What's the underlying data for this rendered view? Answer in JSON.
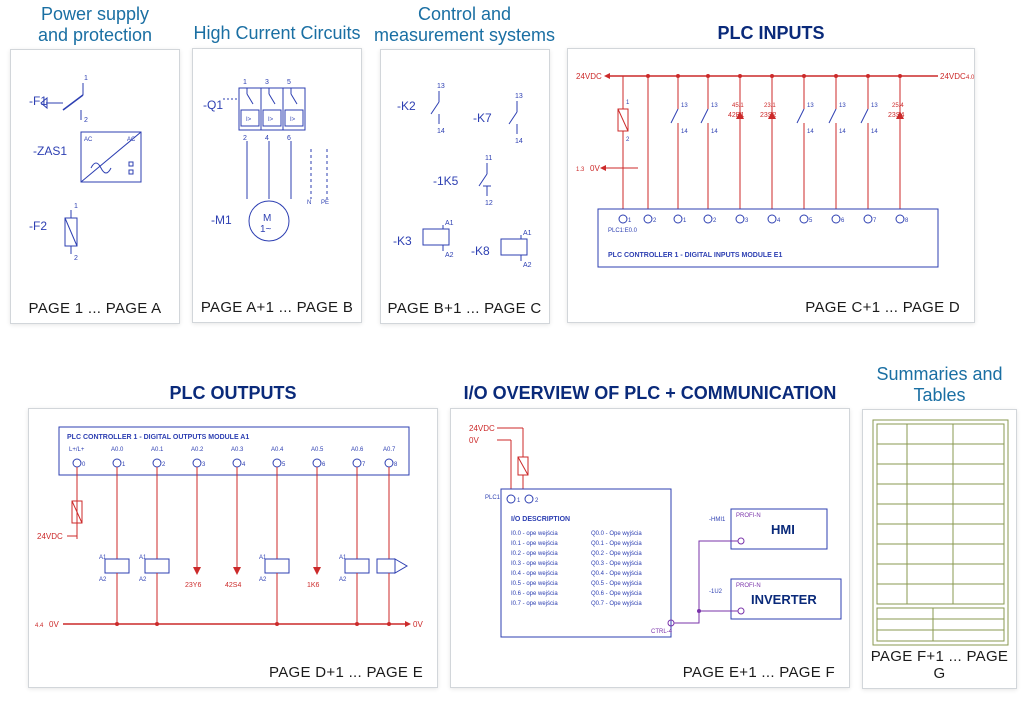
{
  "panels": {
    "power": {
      "title": "Power supply\nand protection",
      "footer": "PAGE 1 ... PAGE A",
      "labels": {
        "F1": "-F1",
        "ZAS1": "-ZAS1",
        "F2": "-F2",
        "AC1": "AC",
        "AC2": "AC",
        "sine": "~"
      }
    },
    "hcc": {
      "title": "High Current Circuits",
      "footer": "PAGE A+1 ... PAGE B",
      "labels": {
        "Q1": "-Q1",
        "M1": "-M1",
        "motor": "M\n1~",
        "I": "I>",
        "N": "N",
        "PE": "PE"
      }
    },
    "control": {
      "title": "Control and\nmeasurement systems",
      "footer": "PAGE B+1 ... PAGE C",
      "labels": {
        "K2": "-K2",
        "K7": "-K7",
        "K1_5": "-1K5",
        "K3": "-K3",
        "K8": "-K8",
        "A1": "A1",
        "A2": "A2"
      }
    },
    "inputs": {
      "title": "PLC INPUTS",
      "footer": "PAGE C+1 ... PAGE D",
      "bus24": "24VDC",
      "bus24r": "24VDC",
      "bus0": "0V",
      "module": "PLC CONTROLLER 1 - DIGITAL INPUTS MODULE E1",
      "pins": [
        "1",
        "2",
        "1",
        "2",
        "1",
        "2",
        "3",
        "4",
        "5",
        "6",
        "7",
        "8"
      ],
      "ref": [
        "42B1",
        "23S2",
        "23S4"
      ],
      "refcoord": [
        "45.1",
        "23.1",
        "25.4"
      ],
      "side": [
        "1.3",
        "4.0"
      ],
      "plcLabel": "PLC1:E0.0",
      "termNums": [
        "1",
        "2",
        "11",
        "12",
        "13",
        "14",
        "11",
        "12",
        "13",
        "14",
        "13",
        "14",
        "13",
        "14",
        "13",
        "14",
        "13",
        "14"
      ]
    },
    "outputs": {
      "title": "PLC OUTPUTS",
      "footer": "PAGE D+1 ... PAGE E",
      "bus24": "24VDC",
      "bus0": "0V",
      "ref0": "4.4",
      "module": "PLC CONTROLLER 1 - DIGITAL OUTPUTS MODULE A1",
      "cols": [
        "L+/L+",
        "A0.0",
        "A0.1",
        "A0.2",
        "A0.3",
        "A0.4",
        "A0.5",
        "A0.6",
        "A0.7"
      ],
      "colnums": [
        "0",
        "1",
        "2",
        "3",
        "4",
        "5",
        "6",
        "7",
        "8"
      ],
      "devs": [
        "",
        "",
        "23Y6",
        "42S4",
        "",
        "1K6",
        "",
        "",
        ""
      ]
    },
    "comm": {
      "title": "I/O OVERVIEW OF PLC + COMMUNICATION",
      "footer": "PAGE E+1 ... PAGE F",
      "bus24": "24VDC",
      "bus0": "0V",
      "plc": "PLC1",
      "ioHeader": "I/O DESCRIPTION",
      "ioLeft": [
        "I0.0 - ope wejścia",
        "I0.1 - ope wejścia",
        "I0.2 - ope wejścia",
        "I0.3 - ope wejścia",
        "I0.4 - ope wejścia",
        "I0.5 - ope wejścia",
        "I0.6 - ope wejścia",
        "I0.7 - ope wejścia"
      ],
      "ioRight": [
        "Q0.0 - Ope wyjścia",
        "Q0.1 - Ope wyjścia",
        "Q0.2 - Ope wyjścia",
        "Q0.3 - Ope wyjścia",
        "Q0.4 - Ope wyjścia",
        "Q0.5 - Ope wyjścia",
        "Q0.6 - Ope wyjścia",
        "Q0.7 - Ope wyjścia"
      ],
      "hmiTag": "-HMI1",
      "hmi": "HMI",
      "invTag": "-1U2",
      "inv": "INVERTER",
      "bus": "PROFI-N",
      "ctrl": "CTRL-4"
    },
    "tables": {
      "title": "Summaries and Tables",
      "footer": "PAGE F+1 ... PAGE G"
    }
  }
}
